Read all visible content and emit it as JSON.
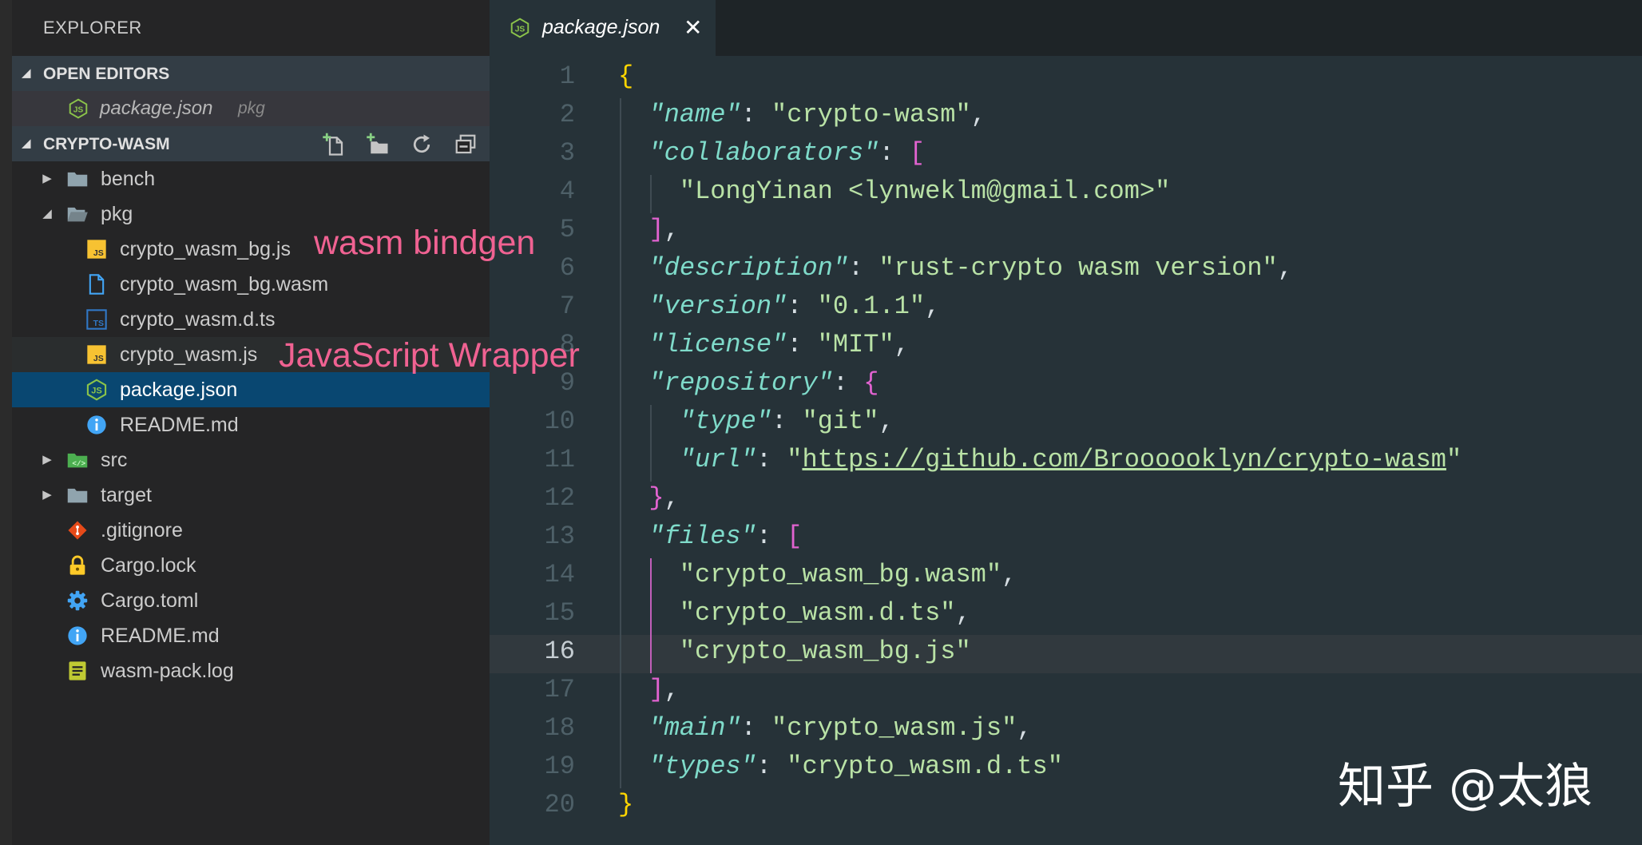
{
  "sidebar": {
    "title": "EXPLORER",
    "open_editors": {
      "header": "OPEN EDITORS",
      "items": [
        {
          "name": "package.json",
          "description": "pkg",
          "icon": "nodejs-icon"
        }
      ]
    },
    "project": {
      "header": "CRYPTO-WASM",
      "toolbar": [
        "new-file-icon",
        "new-folder-icon",
        "refresh-icon",
        "collapse-all-icon"
      ],
      "items": [
        {
          "name": "bench",
          "icon": "folder-icon",
          "kind": "folder",
          "expanded": false
        },
        {
          "name": "pkg",
          "icon": "folder-open-icon",
          "kind": "folder",
          "expanded": true
        },
        {
          "name": "crypto_wasm_bg.js",
          "icon": "javascript-icon",
          "kind": "file"
        },
        {
          "name": "crypto_wasm_bg.wasm",
          "icon": "file-icon",
          "kind": "file"
        },
        {
          "name": "crypto_wasm.d.ts",
          "icon": "typescript-icon",
          "kind": "file"
        },
        {
          "name": "crypto_wasm.js",
          "icon": "javascript-icon",
          "kind": "file"
        },
        {
          "name": "package.json",
          "icon": "nodejs-icon",
          "kind": "file",
          "selected": true
        },
        {
          "name": "README.md",
          "icon": "info-icon",
          "kind": "file"
        },
        {
          "name": "src",
          "icon": "src-folder-icon",
          "kind": "folder",
          "expanded": false
        },
        {
          "name": "target",
          "icon": "folder-icon",
          "kind": "folder",
          "expanded": false
        },
        {
          "name": ".gitignore",
          "icon": "git-icon",
          "kind": "file"
        },
        {
          "name": "Cargo.lock",
          "icon": "lock-icon",
          "kind": "file"
        },
        {
          "name": "Cargo.toml",
          "icon": "gear-icon",
          "kind": "file"
        },
        {
          "name": "README.md",
          "icon": "info-icon",
          "kind": "file"
        },
        {
          "name": "wasm-pack.log",
          "icon": "log-icon",
          "kind": "file"
        }
      ]
    }
  },
  "annotations": {
    "bindgen": "wasm bindgen",
    "wrapper": "JavaScript Wrapper"
  },
  "editor": {
    "tab": {
      "title": "package.json",
      "close": "✕"
    },
    "current_line": 16,
    "lines": [
      [
        [
          "{",
          "brace"
        ]
      ],
      [
        [
          "  ",
          "p"
        ],
        [
          "\"name\"",
          "key"
        ],
        [
          ": ",
          "p"
        ],
        [
          "\"crypto-wasm\"",
          "str"
        ],
        [
          ",",
          "p"
        ]
      ],
      [
        [
          "  ",
          "p"
        ],
        [
          "\"collaborators\"",
          "key"
        ],
        [
          ": ",
          "p"
        ],
        [
          "[",
          "bracket"
        ]
      ],
      [
        [
          "    ",
          "p"
        ],
        [
          "\"LongYinan <lynweklm@gmail.com>\"",
          "str"
        ]
      ],
      [
        [
          "  ",
          "p"
        ],
        [
          "]",
          "bracket"
        ],
        [
          ",",
          "p"
        ]
      ],
      [
        [
          "  ",
          "p"
        ],
        [
          "\"description\"",
          "key"
        ],
        [
          ": ",
          "p"
        ],
        [
          "\"rust-crypto wasm version\"",
          "str"
        ],
        [
          ",",
          "p"
        ]
      ],
      [
        [
          "  ",
          "p"
        ],
        [
          "\"version\"",
          "key"
        ],
        [
          ": ",
          "p"
        ],
        [
          "\"0.1.1\"",
          "str"
        ],
        [
          ",",
          "p"
        ]
      ],
      [
        [
          "  ",
          "p"
        ],
        [
          "\"license\"",
          "key"
        ],
        [
          ": ",
          "p"
        ],
        [
          "\"MIT\"",
          "str"
        ],
        [
          ",",
          "p"
        ]
      ],
      [
        [
          "  ",
          "p"
        ],
        [
          "\"repository\"",
          "key"
        ],
        [
          ": ",
          "p"
        ],
        [
          "{",
          "bracket"
        ]
      ],
      [
        [
          "    ",
          "p"
        ],
        [
          "\"type\"",
          "key"
        ],
        [
          ": ",
          "p"
        ],
        [
          "\"git\"",
          "str"
        ],
        [
          ",",
          "p"
        ]
      ],
      [
        [
          "    ",
          "p"
        ],
        [
          "\"url\"",
          "key"
        ],
        [
          ": ",
          "p"
        ],
        [
          "\"",
          "str"
        ],
        [
          "https://github.com/Broooooklyn/crypto-wasm",
          "url"
        ],
        [
          "\"",
          "str"
        ]
      ],
      [
        [
          "  ",
          "p"
        ],
        [
          "}",
          "bracket"
        ],
        [
          ",",
          "p"
        ]
      ],
      [
        [
          "  ",
          "p"
        ],
        [
          "\"files\"",
          "key"
        ],
        [
          ": ",
          "p"
        ],
        [
          "[",
          "bracket"
        ]
      ],
      [
        [
          "    ",
          "p"
        ],
        [
          "\"crypto_wasm_bg.wasm\"",
          "str"
        ],
        [
          ",",
          "p"
        ]
      ],
      [
        [
          "    ",
          "p"
        ],
        [
          "\"crypto_wasm.d.ts\"",
          "str"
        ],
        [
          ",",
          "p"
        ]
      ],
      [
        [
          "    ",
          "p"
        ],
        [
          "\"crypto_wasm_bg.js\"",
          "str"
        ]
      ],
      [
        [
          "  ",
          "p"
        ],
        [
          "]",
          "bracket"
        ],
        [
          ",",
          "p"
        ]
      ],
      [
        [
          "  ",
          "p"
        ],
        [
          "\"main\"",
          "key"
        ],
        [
          ": ",
          "p"
        ],
        [
          "\"crypto_wasm.js\"",
          "str"
        ],
        [
          ",",
          "p"
        ]
      ],
      [
        [
          "  ",
          "p"
        ],
        [
          "\"types\"",
          "key"
        ],
        [
          ": ",
          "p"
        ],
        [
          "\"crypto_wasm.d.ts\"",
          "str"
        ]
      ],
      [
        [
          "}",
          "brace"
        ]
      ]
    ]
  },
  "watermark": "知乎 @太狼",
  "colors": {
    "sidebar_bg": "#252526",
    "editor_bg": "#263238",
    "selection": "#094771",
    "annotation": "#f06292",
    "json_key": "#7fdbca",
    "json_string": "#b9e2a6",
    "brace": "#ffd600",
    "bracket": "#e163d0"
  }
}
